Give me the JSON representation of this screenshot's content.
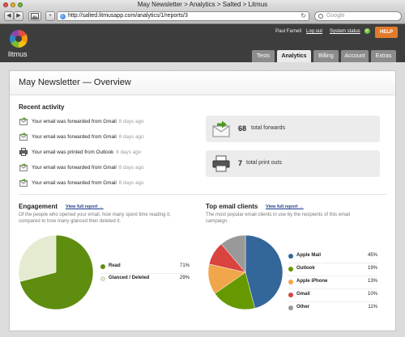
{
  "browser": {
    "window_title": "May Newsletter > Analytics > Salted > Litmus",
    "url": "http://salted.litmusapp.com/analytics/1/reports/3",
    "search_placeholder": "Google",
    "add_tab_label": "+"
  },
  "app": {
    "brand": "litmus",
    "user_name": "Paul Farnell",
    "logout_label": "Log out",
    "system_status_label": "System status",
    "help_label": "HELP",
    "tabs": [
      {
        "label": "Tests"
      },
      {
        "label": "Analytics"
      },
      {
        "label": "Billing"
      },
      {
        "label": "Account"
      },
      {
        "label": "Extras"
      }
    ]
  },
  "page": {
    "title": "May Newsletter — Overview",
    "recent_activity": {
      "heading": "Recent activity",
      "items": [
        {
          "text": "Your email was forwarded from Gmail",
          "ago": "8 days ago",
          "icon": "envelope-forward-icon"
        },
        {
          "text": "Your email was forwarded from Gmail",
          "ago": "8 days ago",
          "icon": "envelope-forward-icon"
        },
        {
          "text": "Your email was printed from Outlook",
          "ago": "8 days ago",
          "icon": "printer-icon"
        },
        {
          "text": "Your email was forwarded from Gmail",
          "ago": "8 days ago",
          "icon": "envelope-forward-icon"
        },
        {
          "text": "Your email was forwarded from Gmail",
          "ago": "8 days ago",
          "icon": "envelope-forward-icon"
        }
      ]
    },
    "stats": [
      {
        "value": "68",
        "label": "total forwards",
        "icon": "envelope-forward-icon"
      },
      {
        "value": "7",
        "label": "total print outs",
        "icon": "printer-icon"
      }
    ],
    "engagement": {
      "heading": "Engagement",
      "link": "View full report →",
      "description": "Of the people who opened your email, how many spent time reading it, compared to how many glanced then deleted it."
    },
    "clients": {
      "heading": "Top email clients",
      "link": "View full report →",
      "description": "The most popular email clients in use by the recipients of this email campaign."
    }
  },
  "colors": {
    "read": "#5f8d0f",
    "glanced": "#e4ebd0",
    "apple_mail": "#336699",
    "outlook": "#669900",
    "apple_iphone": "#f0a64a",
    "gmail": "#d9443f",
    "other": "#999999"
  },
  "chart_data": [
    {
      "type": "pie",
      "categories": [
        "Read",
        "Glanced / Deleted"
      ],
      "values": [
        71,
        29
      ],
      "labels": [
        "71%",
        "29%"
      ]
    },
    {
      "type": "pie",
      "categories": [
        "Apple Mail",
        "Outlook",
        "Apple iPhone",
        "Gmail",
        "Other"
      ],
      "values": [
        45,
        19,
        13,
        10,
        11
      ],
      "labels": [
        "45%",
        "19%",
        "13%",
        "10%",
        "11%"
      ]
    }
  ]
}
